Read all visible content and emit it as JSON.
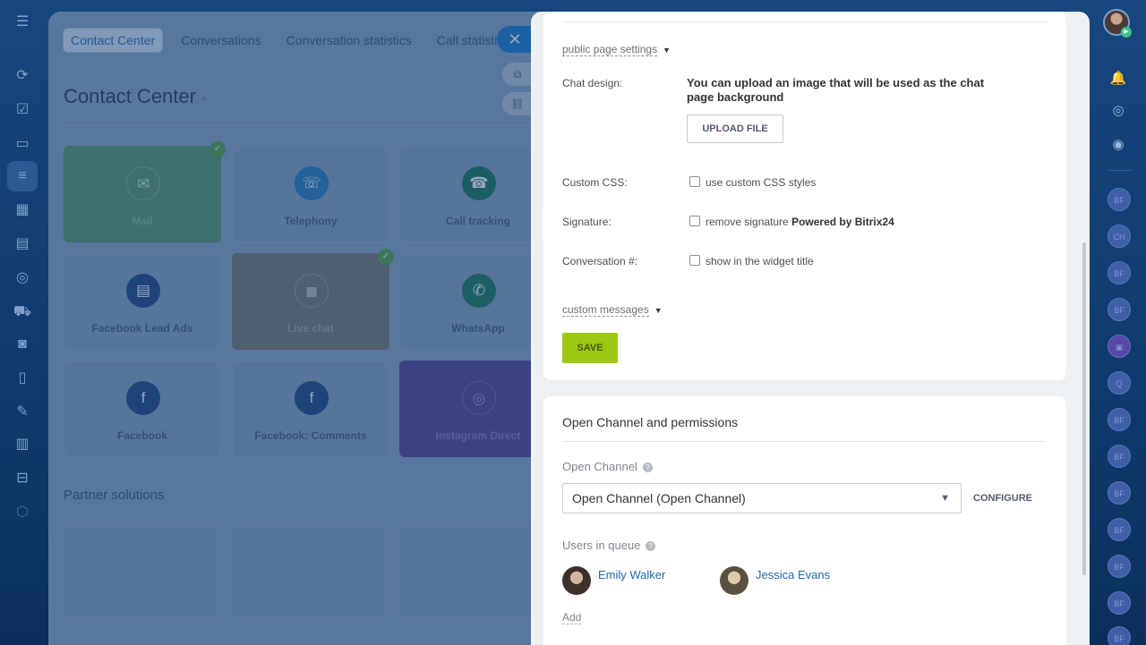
{
  "left_sidebar": {
    "icons": [
      "menu-icon",
      "flow-icon",
      "tasks-icon",
      "chat-icon",
      "contact-center-icon",
      "calendar-icon",
      "drive-icon",
      "target-icon",
      "cart-icon",
      "robot-icon",
      "doc-icon",
      "sign-icon",
      "analytics-icon",
      "inbox-icon",
      "box-icon"
    ]
  },
  "workspace": {
    "tabs": [
      "Contact Center",
      "Conversations",
      "Conversation statistics",
      "Call statistics"
    ],
    "close_glyph": "✕",
    "title": "Contact Center",
    "tiles": [
      {
        "label": "Mail",
        "glyph": "✉",
        "checked": true
      },
      {
        "label": "Telephony",
        "glyph": "☏",
        "checked": false
      },
      {
        "label": "Call tracking",
        "glyph": "☎",
        "checked": false
      },
      {
        "label": "Facebook Lead Ads",
        "glyph": "▤",
        "checked": false
      },
      {
        "label": "Live chat",
        "glyph": "◼",
        "checked": true
      },
      {
        "label": "WhatsApp",
        "glyph": "✆",
        "checked": false
      },
      {
        "label": "Facebook",
        "glyph": "f",
        "checked": false
      },
      {
        "label": "Facebook: Comments",
        "glyph": "f",
        "checked": false
      },
      {
        "label": "Instagram Direct",
        "glyph": "◎",
        "checked": false
      }
    ],
    "partner_title": "Partner solutions"
  },
  "settings": {
    "public_page_settings": "public page settings",
    "chat_design_label": "Chat design:",
    "chat_design_text": "You can upload an image that will be used as the chat page background",
    "upload_button": "UPLOAD FILE",
    "custom_css_label": "Custom CSS:",
    "custom_css_checkbox": "use custom CSS styles",
    "signature_label": "Signature:",
    "signature_checkbox_prefix": "remove signature",
    "signature_checkbox_bold": "Powered by Bitrix24",
    "conversation_label": "Conversation #:",
    "conversation_checkbox": "show in the widget title",
    "custom_messages": "custom messages",
    "save_button": "SAVE"
  },
  "permissions": {
    "title": "Open Channel and permissions",
    "open_channel_label": "Open Channel",
    "open_channel_value": "Open Channel (Open Channel)",
    "configure_button": "CONFIGURE",
    "users_in_queue_label": "Users in queue",
    "users": [
      {
        "name": "Emily Walker"
      },
      {
        "name": "Jessica Evans"
      }
    ],
    "add_link": "Add"
  },
  "right_sidebar": {
    "avatars": [
      "BF",
      "CH",
      "BF",
      "BF",
      "",
      "Q",
      "BF",
      "BF",
      "BF",
      "BF",
      "BF",
      "BF",
      "BF"
    ]
  }
}
